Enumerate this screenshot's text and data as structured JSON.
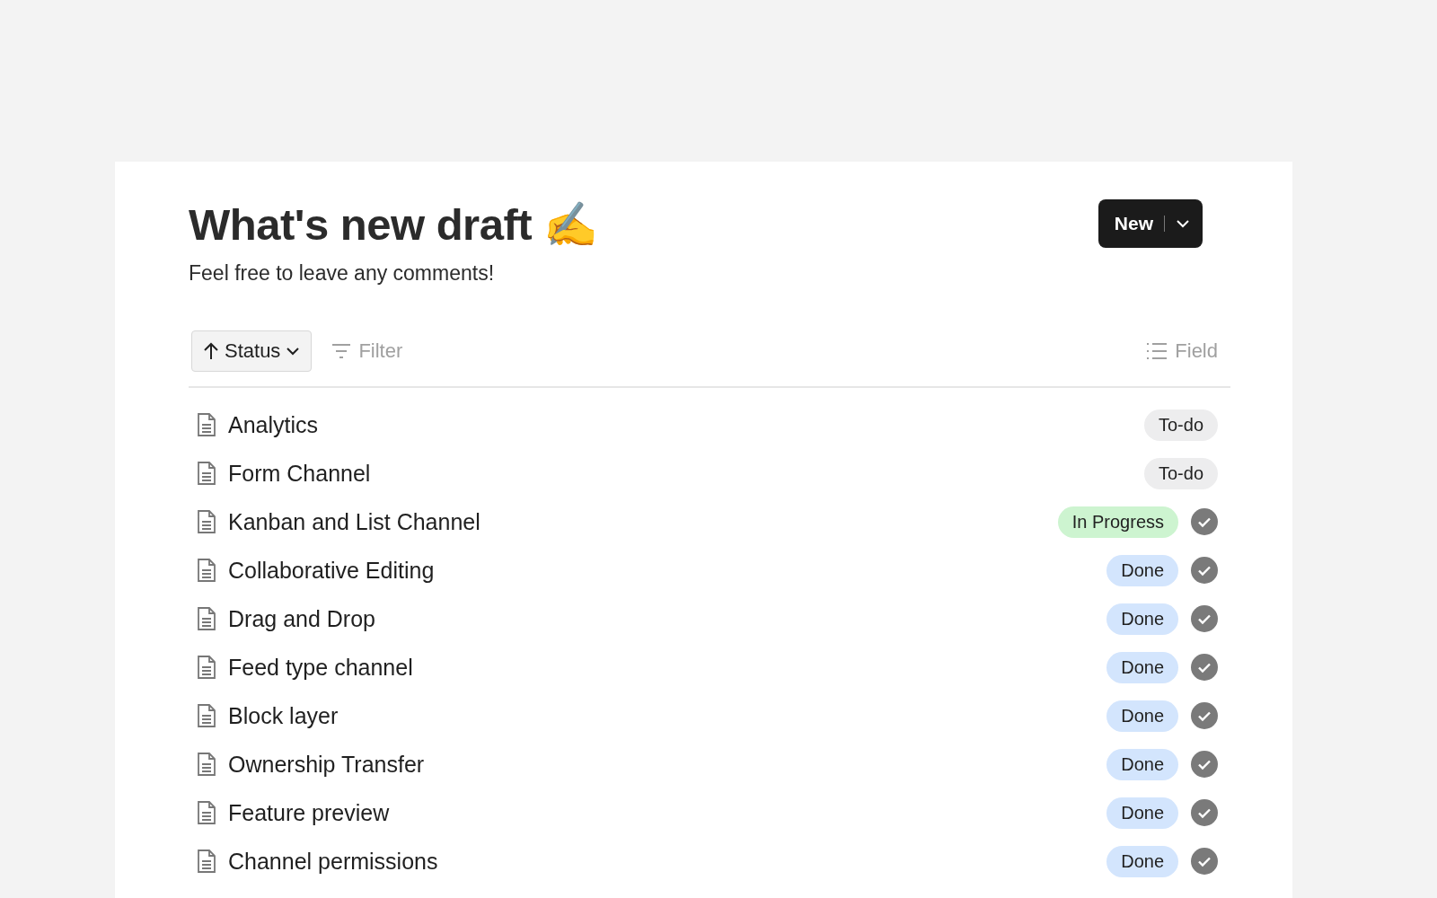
{
  "page": {
    "title": "What's new draft ✍️",
    "description": "Feel free to leave any comments!"
  },
  "new_button": {
    "label": "New"
  },
  "toolbar": {
    "sort": {
      "label": "Status"
    },
    "filter": {
      "label": "Filter"
    },
    "field": {
      "label": "Field"
    }
  },
  "rows": [
    {
      "title": "Analytics",
      "status": "To-do",
      "color": "#ededee",
      "checked": false
    },
    {
      "title": "Form Channel",
      "status": "To-do",
      "color": "#ededee",
      "checked": false
    },
    {
      "title": "Kanban and List Channel",
      "status": "In Progress",
      "color": "#cdf4d0",
      "checked": true
    },
    {
      "title": "Collaborative Editing",
      "status": "Done",
      "color": "#d3e5fd",
      "checked": true
    },
    {
      "title": "Drag and Drop",
      "status": "Done",
      "color": "#d3e5fd",
      "checked": true
    },
    {
      "title": "Feed type channel",
      "status": "Done",
      "color": "#d3e5fd",
      "checked": true
    },
    {
      "title": "Block layer",
      "status": "Done",
      "color": "#d3e5fd",
      "checked": true
    },
    {
      "title": "Ownership Transfer",
      "status": "Done",
      "color": "#d3e5fd",
      "checked": true
    },
    {
      "title": "Feature preview",
      "status": "Done",
      "color": "#d3e5fd",
      "checked": true
    },
    {
      "title": "Channel permissions",
      "status": "Done",
      "color": "#d3e5fd",
      "checked": true
    }
  ]
}
